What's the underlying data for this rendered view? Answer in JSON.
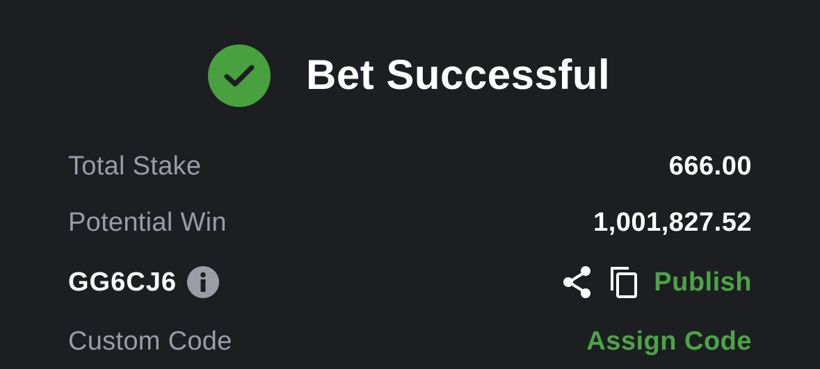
{
  "header": {
    "title": "Bet Successful",
    "icon": "check-circle-icon"
  },
  "summary": {
    "total_stake_label": "Total Stake",
    "total_stake_value": "666.00",
    "potential_win_label": "Potential Win",
    "potential_win_value": "1,001,827.52"
  },
  "booking": {
    "code": "GG6CJ6",
    "info_icon": "info-icon",
    "share_icon": "share-icon",
    "copy_icon": "copy-icon",
    "publish_label": "Publish"
  },
  "custom_code": {
    "label": "Custom Code",
    "assign_label": "Assign Code"
  },
  "colors": {
    "background": "#1d1e22",
    "accent_green": "#48a03e",
    "label_gray": "#9a9ca6",
    "text_white": "#ffffff"
  }
}
